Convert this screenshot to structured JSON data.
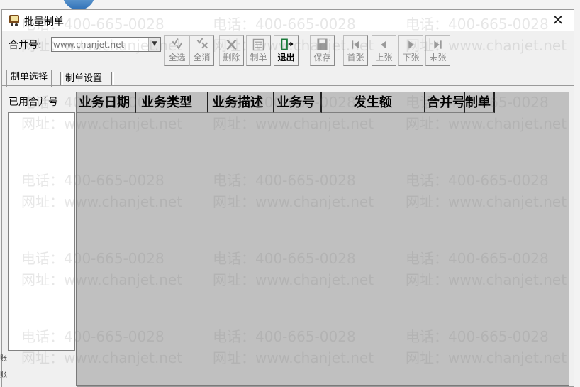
{
  "window": {
    "title": "批量制单",
    "close_glyph": "✕"
  },
  "toolbar": {
    "merge_label": "合并号:",
    "merge_value": "",
    "merge_placeholder": "www.chanjet.net",
    "buttons": [
      {
        "label": "全选",
        "icon": "select-all-icon",
        "enabled": false
      },
      {
        "label": "全消",
        "icon": "deselect-all-icon",
        "enabled": false
      },
      {
        "label": "删除",
        "icon": "delete-icon",
        "enabled": false
      },
      {
        "label": "制单",
        "icon": "voucher-icon",
        "enabled": false
      },
      {
        "label": "退出",
        "icon": "exit-door-icon",
        "enabled": true
      },
      {
        "label": "保存",
        "icon": "save-icon",
        "enabled": false
      },
      {
        "label": "首张",
        "icon": "first-page-icon",
        "enabled": false
      },
      {
        "label": "上张",
        "icon": "prev-page-icon",
        "enabled": false
      },
      {
        "label": "下张",
        "icon": "next-page-icon",
        "enabled": false
      },
      {
        "label": "末张",
        "icon": "last-page-icon",
        "enabled": false
      }
    ]
  },
  "tabs": [
    {
      "label": "制单选择",
      "active": true
    },
    {
      "label": "制单设置",
      "active": false
    }
  ],
  "left_panel": {
    "label": "已用合并号"
  },
  "grid": {
    "columns": [
      "业务日期",
      "业务类型",
      "业务描述",
      "业务号",
      "发生额",
      "合并号",
      "制单"
    ],
    "rows": []
  },
  "watermark": {
    "phone": "电话：400-665-0028",
    "site": "网址：www.chanjet.net"
  },
  "edge_glyphs": [
    "账",
    "账"
  ],
  "colors": {
    "grid_bg": "#c0c0c0",
    "disabled_text": "#8c8c8c",
    "exit_accent": "#1a7a3a"
  }
}
